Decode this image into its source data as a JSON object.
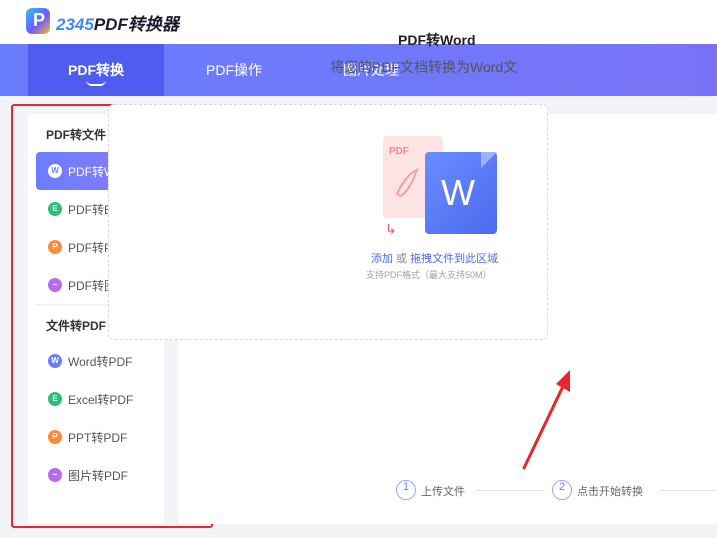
{
  "app": {
    "logo_mark": "P",
    "brand_num": "2345",
    "brand_text": "PDF转换器"
  },
  "nav": {
    "tabs": [
      {
        "label": "PDF转换",
        "active": true
      },
      {
        "label": "PDF操作",
        "active": false
      },
      {
        "label": "图片处理",
        "active": false
      }
    ]
  },
  "sidebar": {
    "section1_title": "PDF转文件",
    "section1_items": [
      {
        "label": "PDF转Word",
        "icon": "word-icon",
        "badge": "W",
        "color": "#4a6bf0",
        "active": true
      },
      {
        "label": "PDF转Excel",
        "icon": "excel-icon",
        "badge": "E",
        "color": "#2bbf7a",
        "active": false
      },
      {
        "label": "PDF转PPT",
        "icon": "ppt-icon",
        "badge": "P",
        "color": "#ff8a3c",
        "active": false
      },
      {
        "label": "PDF转图片",
        "icon": "image-icon",
        "badge": "~",
        "color": "#b86bf2",
        "active": false
      }
    ],
    "section2_title": "文件转PDF",
    "section2_items": [
      {
        "label": "Word转PDF",
        "icon": "word-icon",
        "badge": "W",
        "color": "#6b7dff",
        "active": false
      },
      {
        "label": "Excel转PDF",
        "icon": "excel-icon",
        "badge": "E",
        "color": "#2bbf7a",
        "active": false
      },
      {
        "label": "PPT转PDF",
        "icon": "ppt-icon",
        "badge": "P",
        "color": "#ff8a3c",
        "active": false
      },
      {
        "label": "图片转PDF",
        "icon": "image-icon",
        "badge": "~",
        "color": "#b86bf2",
        "active": false
      }
    ]
  },
  "main": {
    "title": "PDF转Word",
    "subtitle": "将您的PDF文档转换为Word文",
    "pdf_label": "PDF",
    "word_letter": "W",
    "add_link": "添加",
    "or_text": " 或 ",
    "drag_link": "拖拽文件到此区域",
    "support_hint": "支持PDF格式（最大支持50M）",
    "steps": [
      {
        "num": "1",
        "label": "上传文件"
      },
      {
        "num": "2",
        "label": "点击开始转换"
      }
    ]
  },
  "colors": {
    "accent": "#6b7dff",
    "annotation": "#e8262b"
  }
}
